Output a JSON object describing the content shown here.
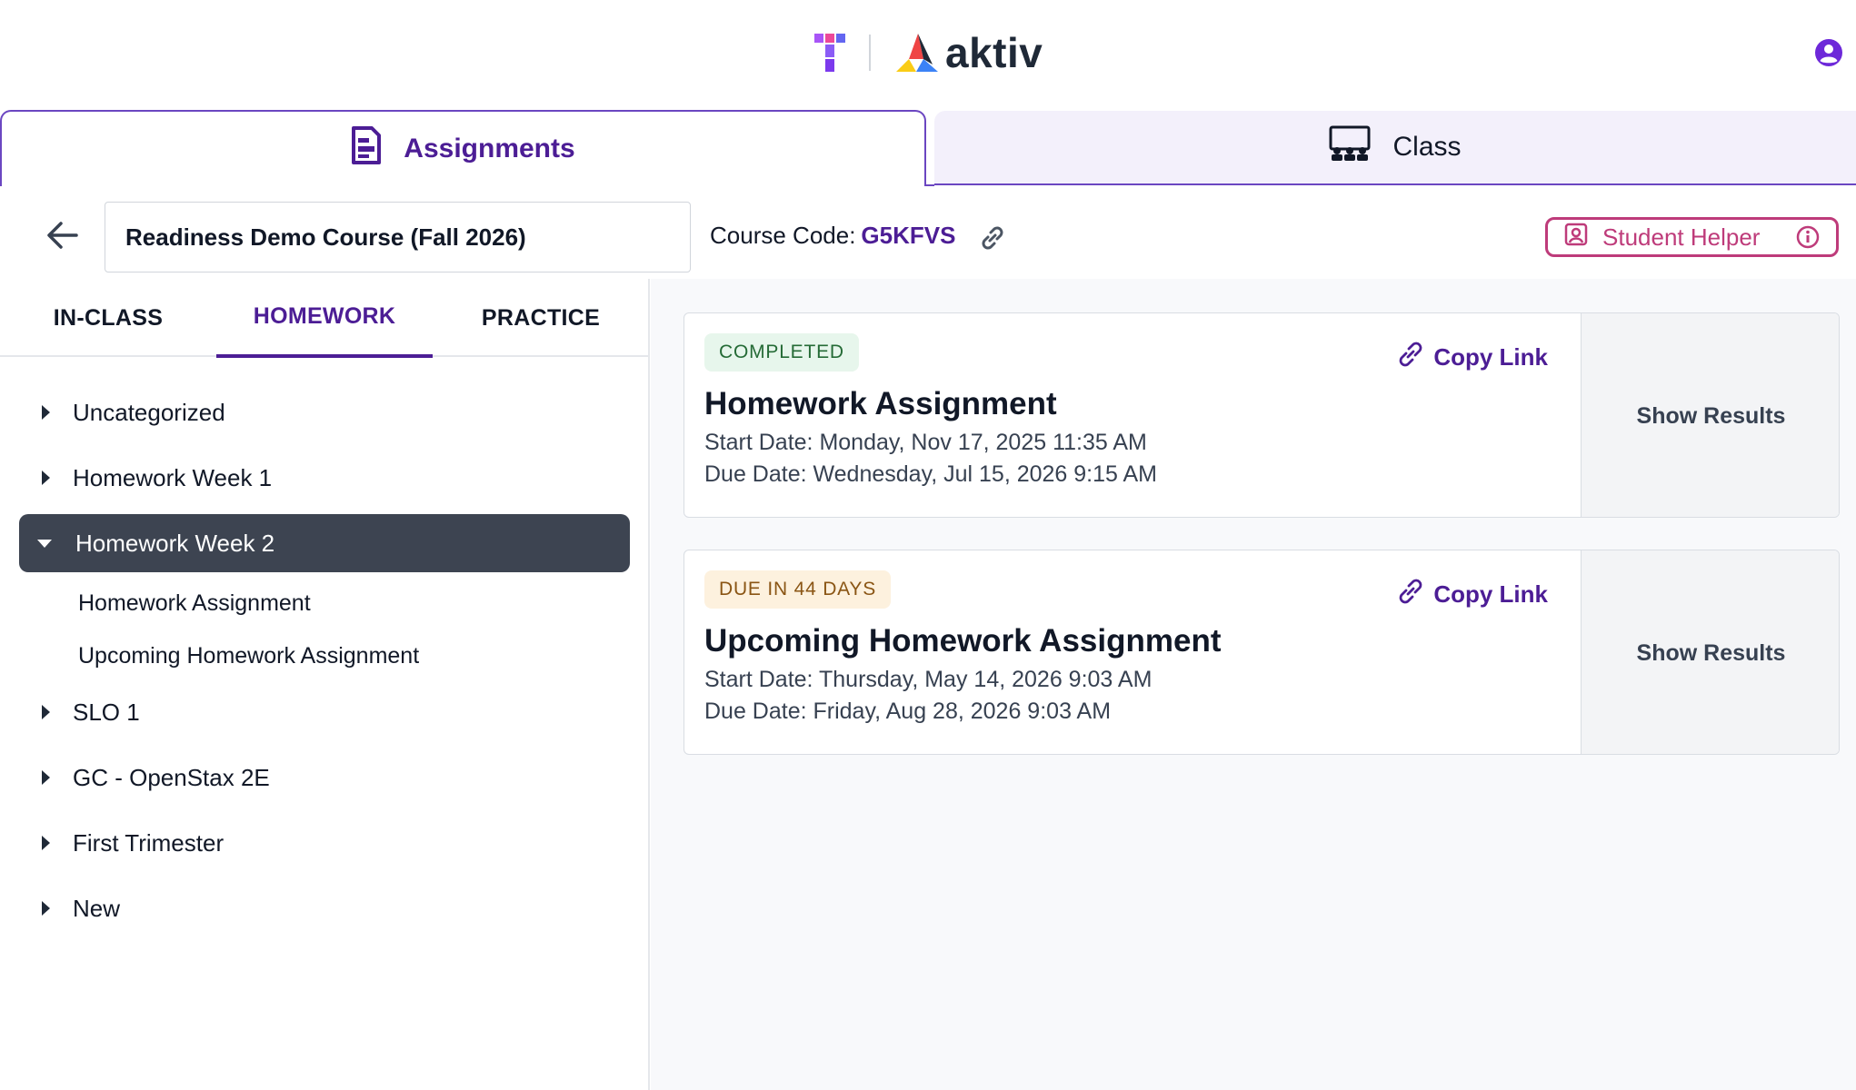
{
  "header": {
    "logo_text": "aktiv",
    "colors": {
      "brand_purple": "#4c1d95",
      "brand_pink": "#be3b7a",
      "active_tree": "#3d4451"
    }
  },
  "main_tabs": [
    {
      "label": "Assignments",
      "icon": "document-icon",
      "active": true
    },
    {
      "label": "Class",
      "icon": "classroom-icon",
      "active": false
    }
  ],
  "course": {
    "name": "Readiness Demo Course (Fall 2026)",
    "code_label": "Course Code:",
    "code": "G5KFVS"
  },
  "student_helper": {
    "label": "Student Helper"
  },
  "sub_tabs": [
    {
      "label": "IN-CLASS",
      "active": false
    },
    {
      "label": "HOMEWORK",
      "active": true
    },
    {
      "label": "PRACTICE",
      "active": false
    }
  ],
  "tree": {
    "items": [
      {
        "label": "Uncategorized"
      },
      {
        "label": "Homework Week 1"
      },
      {
        "label": "Homework Week 2",
        "open": true
      },
      {
        "label": "SLO 1"
      },
      {
        "label": "GC - OpenStax 2E"
      },
      {
        "label": "First Trimester"
      },
      {
        "label": "New"
      }
    ],
    "children": [
      {
        "label": "Homework Assignment"
      },
      {
        "label": "Upcoming Homework Assignment"
      }
    ]
  },
  "assignments": [
    {
      "status": "COMPLETED",
      "title": "Homework Assignment",
      "start": "Start Date: Monday, Nov 17, 2025 11:35 AM",
      "due": "Due Date: Wednesday, Jul 15, 2026 9:15 AM",
      "copy_label": "Copy Link",
      "results_label": "Show Results"
    },
    {
      "status": "DUE IN 44 DAYS",
      "title": "Upcoming Homework Assignment",
      "start": "Start Date: Thursday, May 14, 2026 9:03 AM",
      "due": "Due Date: Friday, Aug 28, 2026 9:03 AM",
      "copy_label": "Copy Link",
      "results_label": "Show Results"
    }
  ]
}
